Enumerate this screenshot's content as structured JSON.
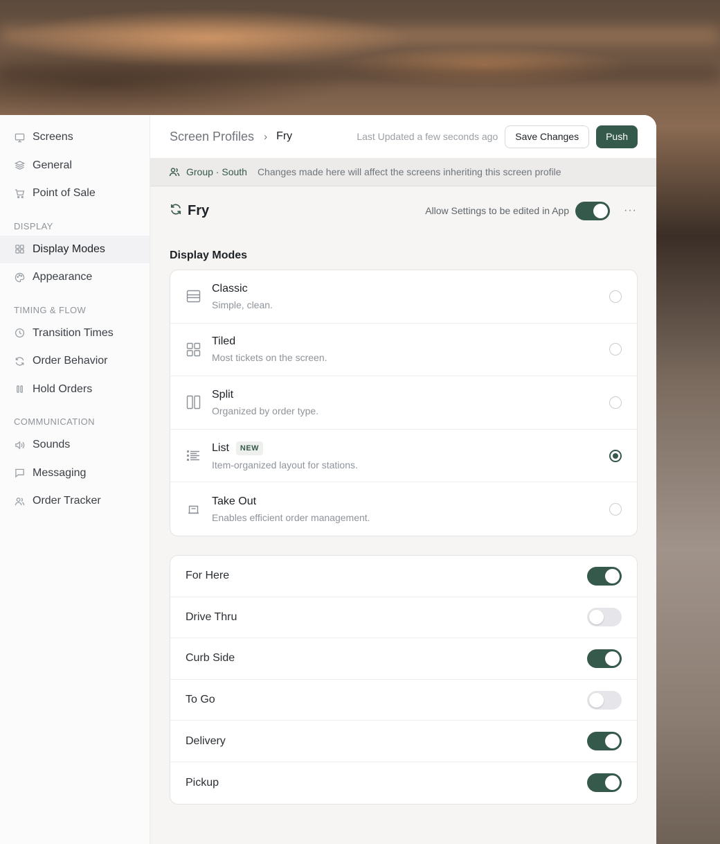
{
  "sidebar": {
    "items_top": [
      {
        "label": "Screens",
        "icon": "monitor-icon"
      },
      {
        "label": "General",
        "icon": "layers-icon"
      },
      {
        "label": "Point of Sale",
        "icon": "cart-icon"
      }
    ],
    "section_display": "DISPLAY",
    "items_display": [
      {
        "label": "Display Modes",
        "icon": "grid-icon",
        "active": true
      },
      {
        "label": "Appearance",
        "icon": "palette-icon"
      }
    ],
    "section_timing": "TIMING & FLOW",
    "items_timing": [
      {
        "label": "Transition Times",
        "icon": "clock-icon"
      },
      {
        "label": "Order Behavior",
        "icon": "refresh-icon"
      },
      {
        "label": "Hold Orders",
        "icon": "pause-icon"
      }
    ],
    "section_comm": "COMMUNICATION",
    "items_comm": [
      {
        "label": "Sounds",
        "icon": "speaker-icon"
      },
      {
        "label": "Messaging",
        "icon": "chat-icon"
      },
      {
        "label": "Order Tracker",
        "icon": "users-icon"
      }
    ]
  },
  "header": {
    "breadcrumb_root": "Screen Profiles",
    "breadcrumb_sep": "›",
    "breadcrumb_current": "Fry",
    "last_updated": "Last Updated a few seconds ago",
    "save_label": "Save Changes",
    "push_label": "Push"
  },
  "group_bar": {
    "group_name": "Group · South",
    "message": "Changes made here will affect the screens inheriting this screen profile"
  },
  "profile": {
    "name": "Fry",
    "allow_label": "Allow Settings to be edited in App",
    "allow_enabled": true,
    "more": "···"
  },
  "display_modes": {
    "title": "Display Modes",
    "selected": "List",
    "options": [
      {
        "title": "Classic",
        "desc": "Simple, clean.",
        "icon": "classic-layout-icon"
      },
      {
        "title": "Tiled",
        "desc": "Most tickets on the screen.",
        "icon": "tiled-layout-icon"
      },
      {
        "title": "Split",
        "desc": "Organized by order type.",
        "icon": "split-layout-icon"
      },
      {
        "title": "List",
        "desc": "Item-organized layout for stations.",
        "icon": "list-layout-icon",
        "badge": "NEW"
      },
      {
        "title": "Take Out",
        "desc": "Enables efficient order management.",
        "icon": "takeout-icon"
      }
    ]
  },
  "order_types": [
    {
      "label": "For Here",
      "enabled": true
    },
    {
      "label": "Drive Thru",
      "enabled": false
    },
    {
      "label": "Curb Side",
      "enabled": true
    },
    {
      "label": "To Go",
      "enabled": false
    },
    {
      "label": "Delivery",
      "enabled": true
    },
    {
      "label": "Pickup",
      "enabled": true
    }
  ],
  "colors": {
    "accent": "#35594a",
    "toggle_off": "#e6e6ea"
  }
}
